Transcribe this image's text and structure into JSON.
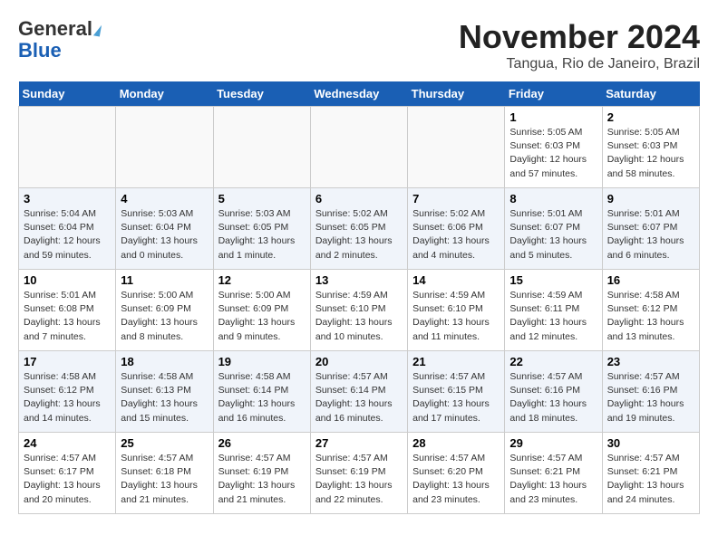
{
  "header": {
    "logo_line1": "General",
    "logo_line2": "Blue",
    "month": "November 2024",
    "location": "Tangua, Rio de Janeiro, Brazil"
  },
  "weekdays": [
    "Sunday",
    "Monday",
    "Tuesday",
    "Wednesday",
    "Thursday",
    "Friday",
    "Saturday"
  ],
  "weeks": [
    [
      {
        "day": "",
        "info": ""
      },
      {
        "day": "",
        "info": ""
      },
      {
        "day": "",
        "info": ""
      },
      {
        "day": "",
        "info": ""
      },
      {
        "day": "",
        "info": ""
      },
      {
        "day": "1",
        "info": "Sunrise: 5:05 AM\nSunset: 6:03 PM\nDaylight: 12 hours\nand 57 minutes."
      },
      {
        "day": "2",
        "info": "Sunrise: 5:05 AM\nSunset: 6:03 PM\nDaylight: 12 hours\nand 58 minutes."
      }
    ],
    [
      {
        "day": "3",
        "info": "Sunrise: 5:04 AM\nSunset: 6:04 PM\nDaylight: 12 hours\nand 59 minutes."
      },
      {
        "day": "4",
        "info": "Sunrise: 5:03 AM\nSunset: 6:04 PM\nDaylight: 13 hours\nand 0 minutes."
      },
      {
        "day": "5",
        "info": "Sunrise: 5:03 AM\nSunset: 6:05 PM\nDaylight: 13 hours\nand 1 minute."
      },
      {
        "day": "6",
        "info": "Sunrise: 5:02 AM\nSunset: 6:05 PM\nDaylight: 13 hours\nand 2 minutes."
      },
      {
        "day": "7",
        "info": "Sunrise: 5:02 AM\nSunset: 6:06 PM\nDaylight: 13 hours\nand 4 minutes."
      },
      {
        "day": "8",
        "info": "Sunrise: 5:01 AM\nSunset: 6:07 PM\nDaylight: 13 hours\nand 5 minutes."
      },
      {
        "day": "9",
        "info": "Sunrise: 5:01 AM\nSunset: 6:07 PM\nDaylight: 13 hours\nand 6 minutes."
      }
    ],
    [
      {
        "day": "10",
        "info": "Sunrise: 5:01 AM\nSunset: 6:08 PM\nDaylight: 13 hours\nand 7 minutes."
      },
      {
        "day": "11",
        "info": "Sunrise: 5:00 AM\nSunset: 6:09 PM\nDaylight: 13 hours\nand 8 minutes."
      },
      {
        "day": "12",
        "info": "Sunrise: 5:00 AM\nSunset: 6:09 PM\nDaylight: 13 hours\nand 9 minutes."
      },
      {
        "day": "13",
        "info": "Sunrise: 4:59 AM\nSunset: 6:10 PM\nDaylight: 13 hours\nand 10 minutes."
      },
      {
        "day": "14",
        "info": "Sunrise: 4:59 AM\nSunset: 6:10 PM\nDaylight: 13 hours\nand 11 minutes."
      },
      {
        "day": "15",
        "info": "Sunrise: 4:59 AM\nSunset: 6:11 PM\nDaylight: 13 hours\nand 12 minutes."
      },
      {
        "day": "16",
        "info": "Sunrise: 4:58 AM\nSunset: 6:12 PM\nDaylight: 13 hours\nand 13 minutes."
      }
    ],
    [
      {
        "day": "17",
        "info": "Sunrise: 4:58 AM\nSunset: 6:12 PM\nDaylight: 13 hours\nand 14 minutes."
      },
      {
        "day": "18",
        "info": "Sunrise: 4:58 AM\nSunset: 6:13 PM\nDaylight: 13 hours\nand 15 minutes."
      },
      {
        "day": "19",
        "info": "Sunrise: 4:58 AM\nSunset: 6:14 PM\nDaylight: 13 hours\nand 16 minutes."
      },
      {
        "day": "20",
        "info": "Sunrise: 4:57 AM\nSunset: 6:14 PM\nDaylight: 13 hours\nand 16 minutes."
      },
      {
        "day": "21",
        "info": "Sunrise: 4:57 AM\nSunset: 6:15 PM\nDaylight: 13 hours\nand 17 minutes."
      },
      {
        "day": "22",
        "info": "Sunrise: 4:57 AM\nSunset: 6:16 PM\nDaylight: 13 hours\nand 18 minutes."
      },
      {
        "day": "23",
        "info": "Sunrise: 4:57 AM\nSunset: 6:16 PM\nDaylight: 13 hours\nand 19 minutes."
      }
    ],
    [
      {
        "day": "24",
        "info": "Sunrise: 4:57 AM\nSunset: 6:17 PM\nDaylight: 13 hours\nand 20 minutes."
      },
      {
        "day": "25",
        "info": "Sunrise: 4:57 AM\nSunset: 6:18 PM\nDaylight: 13 hours\nand 21 minutes."
      },
      {
        "day": "26",
        "info": "Sunrise: 4:57 AM\nSunset: 6:19 PM\nDaylight: 13 hours\nand 21 minutes."
      },
      {
        "day": "27",
        "info": "Sunrise: 4:57 AM\nSunset: 6:19 PM\nDaylight: 13 hours\nand 22 minutes."
      },
      {
        "day": "28",
        "info": "Sunrise: 4:57 AM\nSunset: 6:20 PM\nDaylight: 13 hours\nand 23 minutes."
      },
      {
        "day": "29",
        "info": "Sunrise: 4:57 AM\nSunset: 6:21 PM\nDaylight: 13 hours\nand 23 minutes."
      },
      {
        "day": "30",
        "info": "Sunrise: 4:57 AM\nSunset: 6:21 PM\nDaylight: 13 hours\nand 24 minutes."
      }
    ]
  ]
}
